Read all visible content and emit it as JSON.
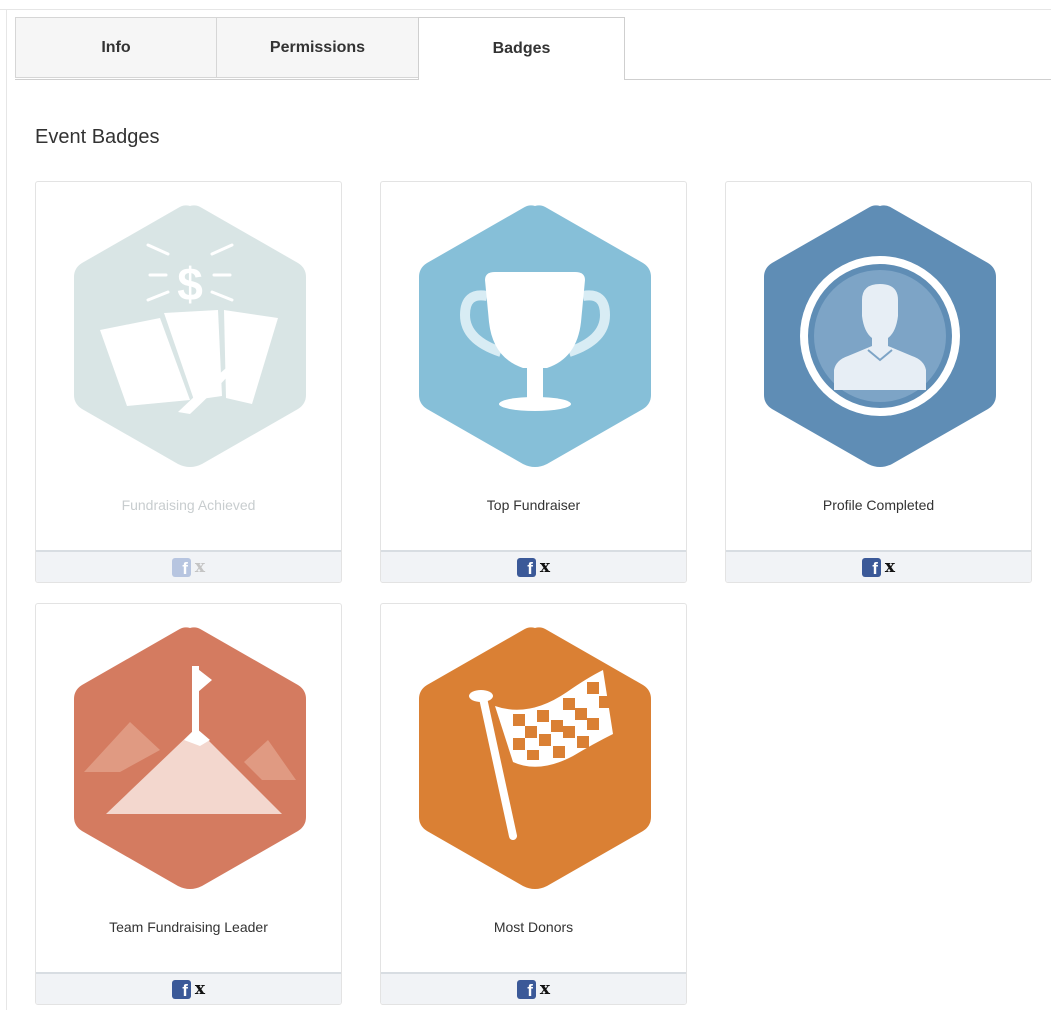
{
  "tabs": [
    {
      "label": "Info",
      "active": false
    },
    {
      "label": "Permissions",
      "active": false
    },
    {
      "label": "Badges",
      "active": true
    }
  ],
  "section_title": "Event Badges",
  "badges": [
    {
      "label": "Fundraising Achieved",
      "icon": "fundraising-achieved-icon",
      "achieved": false,
      "color": "#d9e5e5"
    },
    {
      "label": "Top Fundraiser",
      "icon": "trophy-icon",
      "achieved": true,
      "color": "#86bfd8"
    },
    {
      "label": "Profile Completed",
      "icon": "profile-icon",
      "achieved": true,
      "color": "#5f8db5"
    },
    {
      "label": "Team Fundraising Leader",
      "icon": "mountain-flag-icon",
      "achieved": true,
      "color": "#d47b60"
    },
    {
      "label": "Most Donors",
      "icon": "checkered-flag-icon",
      "achieved": true,
      "color": "#da8034"
    }
  ],
  "share": {
    "facebook": "f",
    "x": "x"
  }
}
